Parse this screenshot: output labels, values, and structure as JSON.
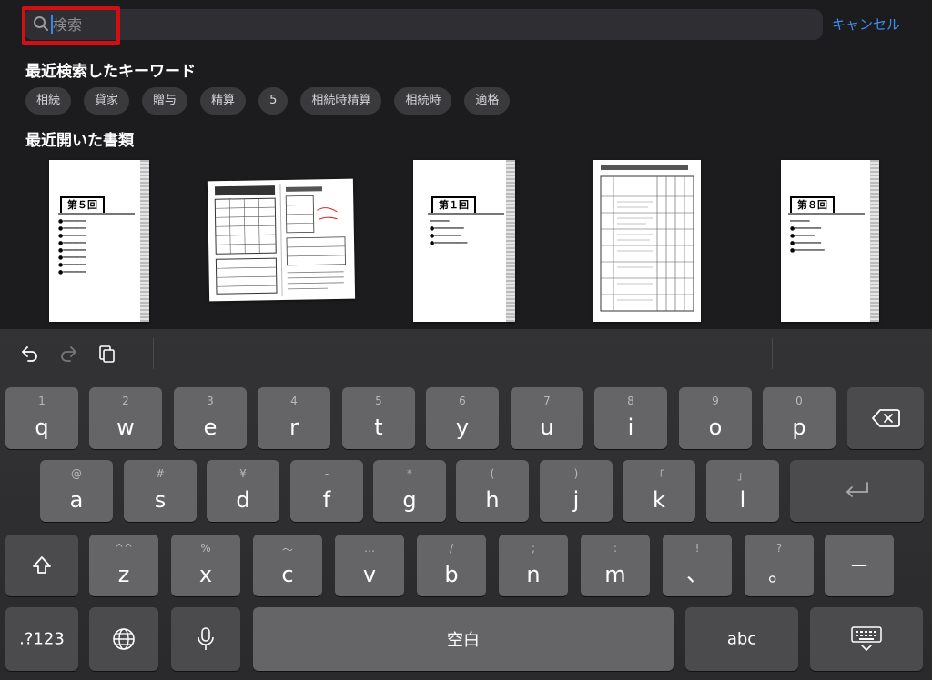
{
  "search": {
    "placeholder": "検索",
    "cancel_label": "キャンセル"
  },
  "recent_keywords": {
    "title": "最近検索したキーワード",
    "items": [
      "相続",
      "貸家",
      "贈与",
      "精算",
      "5",
      "相続時精算",
      "相続時",
      "適格"
    ]
  },
  "recent_docs": {
    "title": "最近開いた書類",
    "items": [
      {
        "type": "cover",
        "label": "第５回"
      },
      {
        "type": "table-spread"
      },
      {
        "type": "cover",
        "label": "第１回"
      },
      {
        "type": "table"
      },
      {
        "type": "cover",
        "label": "第８回"
      }
    ]
  },
  "toolbar": {
    "undo_icon": "undo-icon",
    "redo_icon": "redo-icon",
    "paste_icon": "paste-icon"
  },
  "keyboard": {
    "row1": [
      {
        "hint": "1",
        "key": "q"
      },
      {
        "hint": "2",
        "key": "w"
      },
      {
        "hint": "3",
        "key": "e"
      },
      {
        "hint": "4",
        "key": "r"
      },
      {
        "hint": "5",
        "key": "t"
      },
      {
        "hint": "6",
        "key": "y"
      },
      {
        "hint": "7",
        "key": "u"
      },
      {
        "hint": "8",
        "key": "i"
      },
      {
        "hint": "9",
        "key": "o"
      },
      {
        "hint": "0",
        "key": "p"
      }
    ],
    "row2": [
      {
        "hint": "@",
        "key": "a"
      },
      {
        "hint": "#",
        "key": "s"
      },
      {
        "hint": "¥",
        "key": "d"
      },
      {
        "hint": "-",
        "key": "f"
      },
      {
        "hint": "*",
        "key": "g"
      },
      {
        "hint": "(",
        "key": "h"
      },
      {
        "hint": ")",
        "key": "j"
      },
      {
        "hint": "「",
        "key": "k"
      },
      {
        "hint": "」",
        "key": "l"
      }
    ],
    "row3": [
      {
        "hint": "^^",
        "key": "z"
      },
      {
        "hint": "%",
        "key": "x"
      },
      {
        "hint": "〜",
        "key": "c"
      },
      {
        "hint": "…",
        "key": "v"
      },
      {
        "hint": "/",
        "key": "b"
      },
      {
        "hint": ";",
        "key": "n"
      },
      {
        "hint": ":",
        "key": "m"
      },
      {
        "hint": "!",
        "key": "、"
      },
      {
        "hint": "?",
        "key": "。"
      }
    ],
    "dash_label": "—",
    "numbers_label": ".?123",
    "space_label": "空白",
    "abc_label": "abc"
  }
}
